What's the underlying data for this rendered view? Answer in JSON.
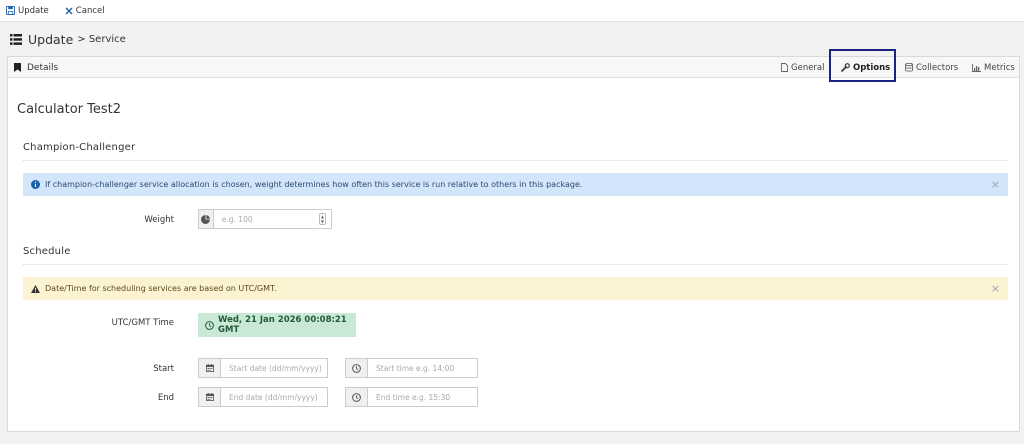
{
  "toolbar": {
    "update_label": "Update",
    "cancel_label": "Cancel"
  },
  "header": {
    "title": "Update",
    "subtitle": "> Service"
  },
  "panel": {
    "heading": "Details",
    "tabs": [
      {
        "label": "General",
        "icon": "file-icon"
      },
      {
        "label": "Options",
        "icon": "wrench-icon",
        "active": true
      },
      {
        "label": "Collectors",
        "icon": "database-icon"
      },
      {
        "label": "Metrics",
        "icon": "chart-icon"
      }
    ]
  },
  "service": {
    "name": "Calculator Test2"
  },
  "champion": {
    "section_title": "Champion-Challenger",
    "info_text": "If champion-challenger service allocation is chosen, weight determines how often this service is run relative to others in this package.",
    "weight_label": "Weight",
    "weight_placeholder": "e.g. 100"
  },
  "schedule": {
    "section_title": "Schedule",
    "warning_text": "Date/Time for scheduling services are based on UTC/GMT.",
    "utc_label": "UTC/GMT Time",
    "utc_value": "Wed, 21 Jan 2026 00:08:21 GMT",
    "start_label": "Start",
    "start_date_placeholder": "Start date (dd/mm/yyyy)",
    "start_time_placeholder": "Start time e.g. 14:00",
    "end_label": "End",
    "end_date_placeholder": "End date (dd/mm/yyyy)",
    "end_time_placeholder": "End time e.g. 15:30"
  },
  "colors": {
    "info_bg": "#d3e5fb",
    "warning_bg": "#fcf3d2",
    "success_bg": "#c9e8d5",
    "highlight_border": "#1a237e"
  }
}
